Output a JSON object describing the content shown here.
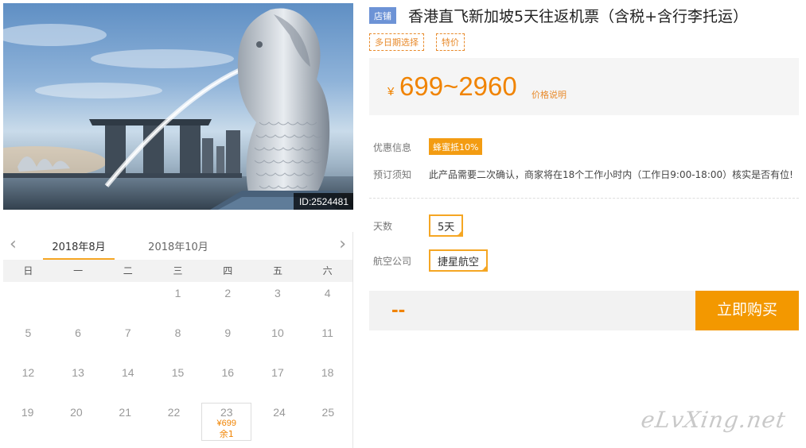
{
  "hero": {
    "image_id": "ID:2524481"
  },
  "calendar": {
    "tabs": [
      "2018年8月",
      "2018年10月"
    ],
    "weekdays": [
      "日",
      "一",
      "二",
      "三",
      "四",
      "五",
      "六"
    ],
    "rows": [
      [
        "",
        "",
        "",
        "1",
        "2",
        "3",
        "4"
      ],
      [
        "5",
        "6",
        "7",
        "8",
        "9",
        "10",
        "11"
      ],
      [
        "12",
        "13",
        "14",
        "15",
        "16",
        "17",
        "18"
      ],
      [
        "19",
        "20",
        "21",
        "22",
        "23",
        "24",
        "25"
      ]
    ],
    "selected": {
      "day": "23",
      "price": "¥699",
      "stock": "余1"
    }
  },
  "product": {
    "shop_badge": "店铺",
    "title": "香港直飞新加坡5天往返机票（含税+含行李托运）",
    "tags": [
      "多日期选择",
      "特价"
    ],
    "price_symbol": "¥",
    "price_range": "699~2960",
    "price_note": "价格说明",
    "promo_label": "优惠信息",
    "promo_badge": "蜂蜜抵10%",
    "notice_label": "预订须知",
    "notice_text": "此产品需要二次确认，商家将在18个工作小时内（工作日9:00-18:00）核实是否有位!",
    "days_label": "天数",
    "days_value": "5天",
    "airline_label": "航空公司",
    "airline_value": "捷星航空",
    "total": "--",
    "buy_label": "立即购买"
  },
  "watermark": "eLvXing.net",
  "colors": {
    "accent": "#f08300",
    "button": "#f39800",
    "shop_badge": "#6d93d6"
  }
}
